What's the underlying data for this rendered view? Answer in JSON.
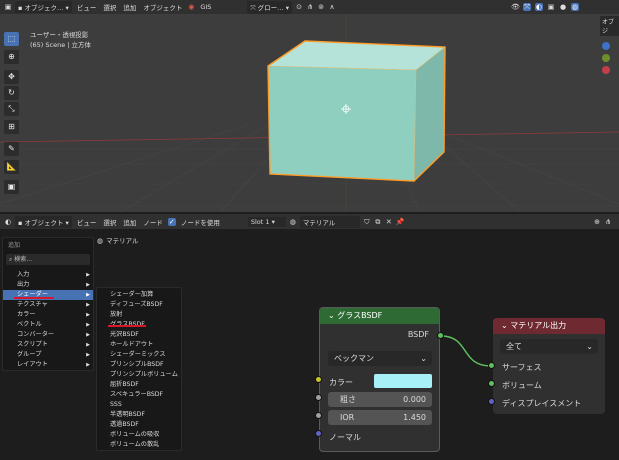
{
  "top_header": {
    "mode": "オブジェク…",
    "menus": [
      "ビュー",
      "選択",
      "追加",
      "オブジェクト"
    ],
    "gis": "GIS",
    "transform": "グロー…",
    "right_tab": "オブジ"
  },
  "viewport": {
    "view_name": "ユーザー・透視投影",
    "scene_info": "(65) Scene | 立方体",
    "colors": {
      "cube": "#8fcfc0",
      "outline": "#ff9d2a"
    }
  },
  "node_header": {
    "mode": "オブジェクト",
    "menus": [
      "ビュー",
      "選択",
      "追加",
      "ノード"
    ],
    "use_nodes": "ノードを使用",
    "slot": "Slot 1",
    "material": "マテリアル"
  },
  "breadcrumb": "マテリアル",
  "add_menu": {
    "title": "追加",
    "search_placeholder": "検索...",
    "items": [
      "入力",
      "出力",
      "シェーダー",
      "テクスチャ",
      "カラー",
      "ベクトル",
      "コンバーター",
      "スクリプト",
      "グループ",
      "レイアウト"
    ],
    "selected_index": 2
  },
  "shader_submenu": {
    "items": [
      "シェーダー加算",
      "ディフューズBSDF",
      "放射",
      "グラスBSDF",
      "光沢BSDF",
      "ホールドアウト",
      "シェーダーミックス",
      "プリンシプルBSDF",
      "プリンシプルボリューム",
      "屈折BSDF",
      "スペキュラーBSDF",
      "SSS",
      "半透明BSDF",
      "透過BSDF",
      "ボリュームの吸収",
      "ボリュームの散乱"
    ]
  },
  "glass_node": {
    "title": "グラスBSDF",
    "output": "BSDF",
    "distribution": "ベックマン",
    "color_label": "カラー",
    "color_value": "#a8f0f7",
    "roughness_label": "粗さ",
    "roughness_value": "0.000",
    "ior_label": "IOR",
    "ior_value": "1.450",
    "normal_label": "ノーマル",
    "header_color": "#2e6b34"
  },
  "output_node": {
    "title": "マテリアル出力",
    "target": "全て",
    "inputs": [
      "サーフェス",
      "ボリューム",
      "ディスプレイスメント"
    ],
    "header_color": "#6e2a30"
  }
}
